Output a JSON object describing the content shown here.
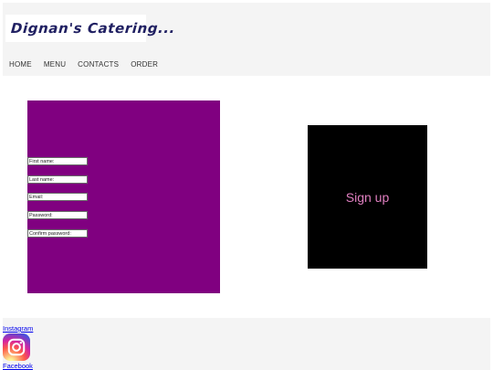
{
  "header": {
    "logo_text": "Dignan's Catering...",
    "nav": [
      "HOME",
      "MENU",
      "CONTACTS",
      "ORDER"
    ]
  },
  "form": {
    "first_name": "First name:",
    "last_name": "Last name:",
    "email": "Email:",
    "password": "Password:",
    "confirm_password": "Confirm password:"
  },
  "signup": {
    "label": "Sign up"
  },
  "footer": {
    "instagram": "Instagram",
    "facebook": "Facebook"
  },
  "colors": {
    "form_panel": "#800080",
    "signup_bg": "#000000",
    "signup_text": "#e07fc0",
    "header_bg": "#f4f4f4",
    "link": "#0000ee"
  },
  "icons": {
    "instagram": "instagram-icon"
  }
}
